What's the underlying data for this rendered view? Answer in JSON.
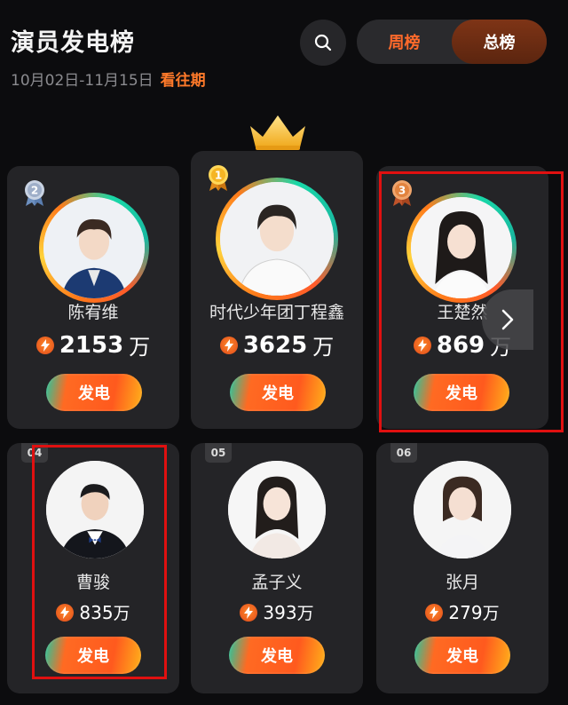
{
  "header": {
    "title": "演员发电榜",
    "date_range": "10月02日-11月15日",
    "history_link": "看往期",
    "search_icon": "search-icon",
    "tabs": [
      {
        "label": "周榜",
        "active": false
      },
      {
        "label": "总榜",
        "active": true
      }
    ]
  },
  "colors": {
    "accent": "#ff6a2b",
    "background": "#0c0c0e",
    "card": "#242427",
    "highlight": "#e01010"
  },
  "ranking": [
    {
      "rank": "2",
      "badge": "silver-medal-icon",
      "name": "陈宥维",
      "value": "2153",
      "unit": "万",
      "button": "发电"
    },
    {
      "rank": "1",
      "badge": "gold-medal-icon",
      "name": "时代少年团丁程鑫",
      "value": "3625",
      "unit": "万",
      "button": "发电"
    },
    {
      "rank": "3",
      "badge": "bronze-medal-icon",
      "name": "王楚然",
      "value": "869",
      "unit": "万",
      "button": "发电"
    },
    {
      "rank": "04",
      "badge": "rank-tag",
      "name": "曹骏",
      "value": "835",
      "unit": "万",
      "button": "发电"
    },
    {
      "rank": "05",
      "badge": "rank-tag",
      "name": "孟子义",
      "value": "393",
      "unit": "万",
      "button": "发电"
    },
    {
      "rank": "06",
      "badge": "rank-tag",
      "name": "张月",
      "value": "279",
      "unit": "万",
      "button": "发电"
    }
  ]
}
